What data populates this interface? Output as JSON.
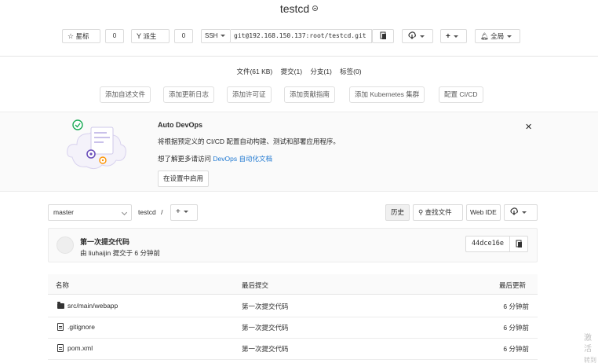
{
  "project": {
    "name": "testcd"
  },
  "actions": {
    "star_label": "星标",
    "star_count": "0",
    "fork_label": "派生",
    "fork_count": "0",
    "clone_protocol": "SSH",
    "clone_url": "git@192.168.150.137:root/testcd.git",
    "notification_label": "全局"
  },
  "stats": {
    "files": "文件(61 KB)",
    "commits": "提交(1)",
    "branches": "分支(1)",
    "tags": "标签(0)"
  },
  "quick_add": [
    "添加自述文件",
    "添加更新日志",
    "添加许可证",
    "添加贡献指南",
    "添加 Kubernetes 集群",
    "配置 CI/CD"
  ],
  "auto_devops": {
    "title": "Auto DevOps",
    "description": "将根据预定义的 CI/CD 配置自动构建、测试和部署应用程序。",
    "learn_prefix": "想了解更多请访问 ",
    "learn_link": "DevOps 自动化文档",
    "enable_button": "在设置中启用"
  },
  "repo": {
    "branch": "master",
    "breadcrumb_root": "testcd",
    "breadcrumb_sep": "/",
    "history_button": "历史",
    "find_file_button": "查找文件",
    "web_ide_button": "Web IDE"
  },
  "last_commit": {
    "title": "第一次提交代码",
    "meta": "由 liuhaijin 提交于 6 分钟前",
    "sha": "44dce16e"
  },
  "file_table": {
    "headers": {
      "name": "名称",
      "last_commit": "最后提交",
      "last_update": "最后更新"
    },
    "rows": [
      {
        "type": "folder",
        "name": "src/main/webapp",
        "commit": "第一次提交代码",
        "updated": "6 分钟前"
      },
      {
        "type": "file",
        "name": ".gitignore",
        "commit": "第一次提交代码",
        "updated": "6 分钟前"
      },
      {
        "type": "file",
        "name": "pom.xml",
        "commit": "第一次提交代码",
        "updated": "6 分钟前"
      }
    ]
  },
  "watermark": {
    "line1": "激活",
    "line2": "转到"
  }
}
